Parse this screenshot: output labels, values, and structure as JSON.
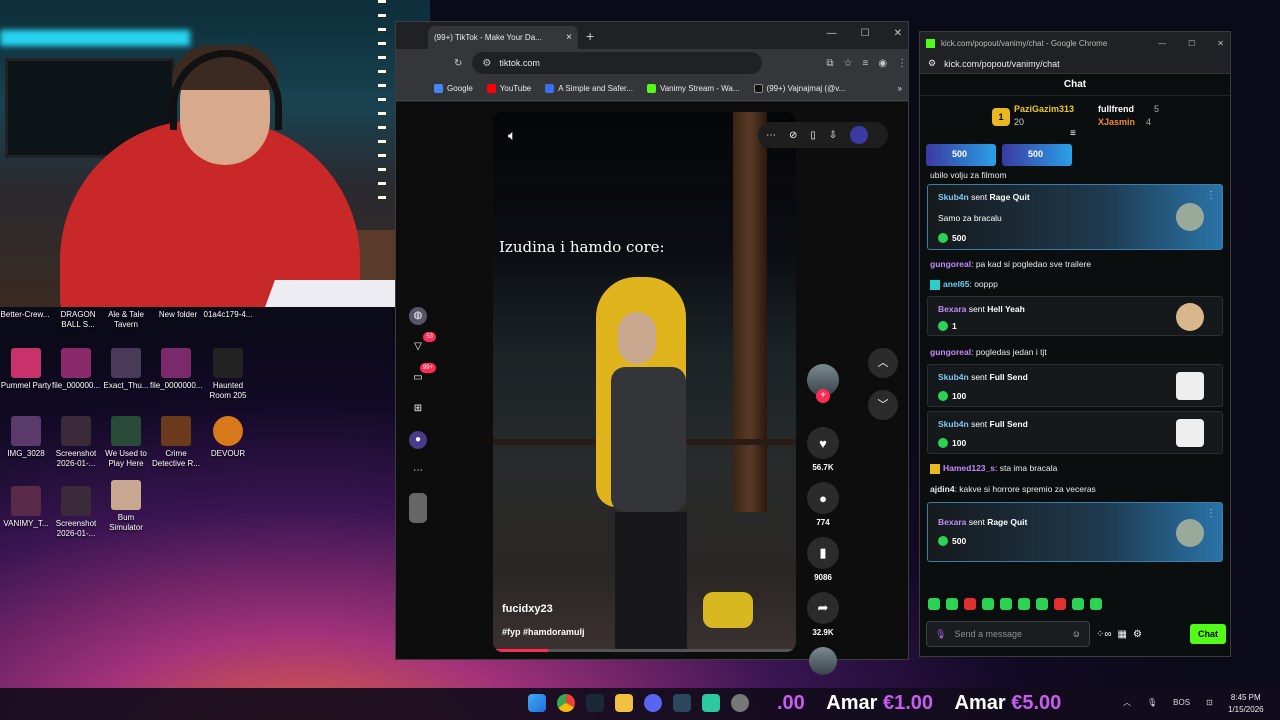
{
  "desktop": {
    "icons_row0": [
      "Better-Crew...",
      "DRAGON BALL S...",
      "Ale & Tale Tavern",
      "New folder",
      "01a4c179-4..."
    ],
    "icons": [
      {
        "label": "Pummel Party"
      },
      {
        "label": "file_000000..."
      },
      {
        "label": "Exact_Thu..."
      },
      {
        "label": "file_0000000..."
      },
      {
        "label": "Haunted Room 205"
      },
      {
        "label": "IMG_3028"
      },
      {
        "label": "Screenshot 2026-01-..."
      },
      {
        "label": "We Used to Play Here"
      },
      {
        "label": "Crime Detective R..."
      },
      {
        "label": "DEVOUR"
      },
      {
        "label": "VANIMY_T..."
      },
      {
        "label": "Screenshot 2026-01-..."
      },
      {
        "label": "Bum Simulator"
      }
    ]
  },
  "browser": {
    "tab_title": "(99+) TikTok - Make Your Da...",
    "url": "tiktok.com",
    "bookmarks": [
      {
        "label": "Google",
        "color": "#4285f4"
      },
      {
        "label": "YouTube",
        "color": "#ff0000"
      },
      {
        "label": "A Simple and Safer...",
        "color": "#3a6ff0"
      },
      {
        "label": "Vanimy Stream - Wa...",
        "color": "#53fc18"
      },
      {
        "label": "(99+) Vajnajmaj (@v...",
        "color": "#111111"
      }
    ]
  },
  "tiktok": {
    "sidebar": {
      "notif_badge": "53",
      "inbox_badge": "99+"
    },
    "video": {
      "caption": "Izudina i hamdo core:",
      "username": "fucidxy23",
      "tags": "#fyp #hamdoramulj",
      "progress": 0.18
    },
    "actions": {
      "likes": "56.7K",
      "comments": "774",
      "saves": "9086",
      "shares": "32.9K"
    }
  },
  "kick": {
    "window_title": "kick.com/popout/vanimy/chat - Google Chrome",
    "url": "kick.com/popout/vanimy/chat",
    "header": "Chat",
    "leaderboard": {
      "first": {
        "rank": "1",
        "name": "PaziGazim313",
        "score": "20"
      },
      "second": {
        "name": "fullfrend",
        "score": "5"
      },
      "third": {
        "name": "XJasmin",
        "score": "4"
      }
    },
    "pinned": [
      {
        "amount": "500"
      },
      {
        "amount": "500"
      }
    ],
    "messages": {
      "m1": "ubilo volju za filmom",
      "card1": {
        "user": "Skub4n",
        "verb": "sent",
        "item": "Rage Quit",
        "note": "Samo za bracalu",
        "amount": "500"
      },
      "m2_user": "gungoreal",
      "m2_text": ": pa kad si pogledao sve trailere",
      "m3_user": "anel65",
      "m3_text": ": ooppp",
      "card2": {
        "user": "Bexara",
        "verb": "sent",
        "item": "Hell Yeah",
        "amount": "1"
      },
      "m4_user": "gungoreal",
      "m4_text": ": pogledas jedan i tjt",
      "card3": {
        "user": "Skub4n",
        "verb": "sent",
        "item": "Full Send",
        "amount": "100"
      },
      "card4": {
        "user": "Skub4n",
        "verb": "sent",
        "item": "Full Send",
        "amount": "100"
      },
      "m5_user": "Hamed123_s",
      "m5_text": ": sta ima bracala",
      "m6_user": "ajdin4",
      "m6_text": ": kakve si horrore spremio za veceras",
      "card5": {
        "user": "Bexara",
        "verb": "sent",
        "item": "Rage Quit",
        "amount": "500"
      }
    },
    "input_placeholder": "Send a message",
    "chat_button": "Chat"
  },
  "taskbar": {
    "ticker": [
      {
        "prefix": ".00"
      },
      {
        "name": "Amar",
        "amount": "€1.00"
      },
      {
        "name": "Amar",
        "amount": "€5.00"
      }
    ],
    "lang": "BOS",
    "time": "8:45 PM",
    "date": "1/15/2026"
  }
}
